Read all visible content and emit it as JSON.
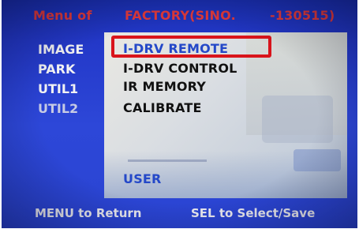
{
  "header": {
    "menu_of": "Menu of",
    "factory": "FACTORY(SINO.",
    "code": "-130515)"
  },
  "left_menu": {
    "items": [
      "IMAGE",
      "PARK",
      "UTIL1",
      "UTIL2"
    ]
  },
  "submenu": {
    "items": [
      "I-DRV REMOTE",
      "I-DRV CONTROL",
      "IR MEMORY",
      "CALIBRATE"
    ],
    "selected": "I-DRV REMOTE",
    "user": "USER"
  },
  "footer": {
    "left": "MENU to Return",
    "right": "SEL to Select/Save"
  },
  "colors": {
    "screen_blue": "#2338c8",
    "header_red": "#e23a3a",
    "selection_red": "#d9141b",
    "highlight_blue": "#2448c8"
  }
}
